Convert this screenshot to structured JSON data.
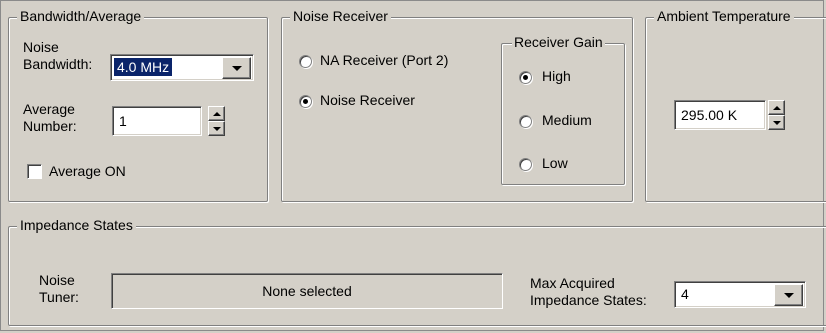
{
  "bandwidth": {
    "legend": "Bandwidth/Average",
    "noise_bw_label_line1": "Noise",
    "noise_bw_label_line2": "Bandwidth:",
    "noise_bw_value": "4.0 MHz",
    "avg_number_label_line1": "Average",
    "avg_number_label_line2": "Number:",
    "avg_number_value": "1",
    "average_on_label": "Average ON",
    "average_on_checked": false
  },
  "noise_receiver": {
    "legend": "Noise Receiver",
    "options": [
      {
        "label": "NA Receiver (Port 2)",
        "checked": false
      },
      {
        "label": "Noise Receiver",
        "checked": true
      }
    ],
    "gain": {
      "legend": "Receiver Gain",
      "options": [
        {
          "label": "High",
          "checked": true
        },
        {
          "label": "Medium",
          "checked": false
        },
        {
          "label": "Low",
          "checked": false
        }
      ]
    }
  },
  "ambient": {
    "legend": "Ambient Temperature",
    "value": "295.00 K"
  },
  "impedance": {
    "legend": "Impedance States",
    "tuner_label_line1": "Noise",
    "tuner_label_line2": "Tuner:",
    "tuner_value": "None selected",
    "max_label_line1": "Max Acquired",
    "max_label_line2": "Impedance States:",
    "max_value": "4"
  },
  "colors": {
    "face": "#d4d0c8",
    "selection": "#0a246a"
  }
}
